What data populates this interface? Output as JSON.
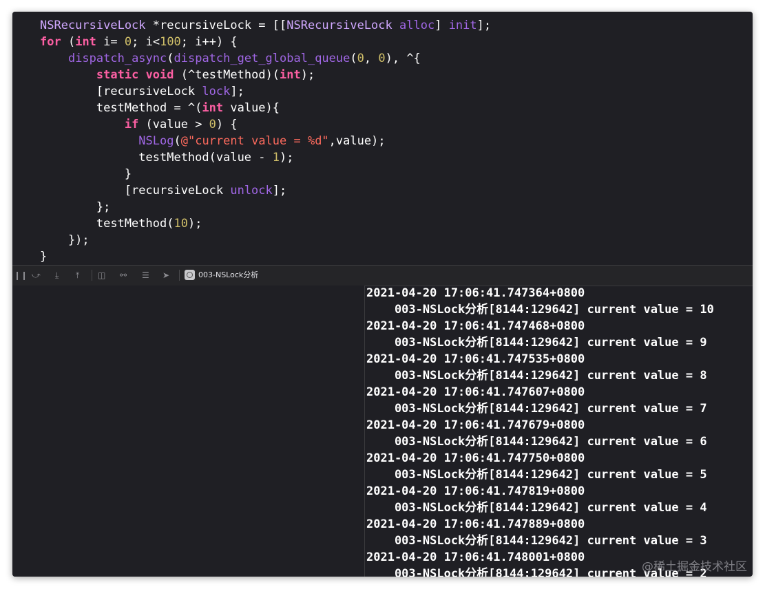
{
  "editor": {
    "lines": [
      [
        {
          "t": "NSRecursiveLock",
          "c": "cls"
        },
        {
          "t": " *recursiveLock = [[",
          "c": "plain"
        },
        {
          "t": "NSRecursiveLock",
          "c": "cls"
        },
        {
          "t": " ",
          "c": "plain"
        },
        {
          "t": "alloc",
          "c": "fn"
        },
        {
          "t": "] ",
          "c": "plain"
        },
        {
          "t": "init",
          "c": "fn"
        },
        {
          "t": "];",
          "c": "plain"
        }
      ],
      [
        {
          "t": "for",
          "c": "kw"
        },
        {
          "t": " (",
          "c": "plain"
        },
        {
          "t": "int",
          "c": "kw"
        },
        {
          "t": " i= ",
          "c": "plain"
        },
        {
          "t": "0",
          "c": "num"
        },
        {
          "t": "; i<",
          "c": "plain"
        },
        {
          "t": "100",
          "c": "num"
        },
        {
          "t": "; i++) {",
          "c": "plain"
        }
      ],
      [
        {
          "t": "    ",
          "c": "plain"
        },
        {
          "t": "dispatch_async",
          "c": "fn"
        },
        {
          "t": "(",
          "c": "plain"
        },
        {
          "t": "dispatch_get_global_queue",
          "c": "fn"
        },
        {
          "t": "(",
          "c": "plain"
        },
        {
          "t": "0",
          "c": "num"
        },
        {
          "t": ", ",
          "c": "plain"
        },
        {
          "t": "0",
          "c": "num"
        },
        {
          "t": "), ^{",
          "c": "plain"
        }
      ],
      [
        {
          "t": "        ",
          "c": "plain"
        },
        {
          "t": "static",
          "c": "kw"
        },
        {
          "t": " ",
          "c": "plain"
        },
        {
          "t": "void",
          "c": "kw"
        },
        {
          "t": " (^testMethod)(",
          "c": "plain"
        },
        {
          "t": "int",
          "c": "kw"
        },
        {
          "t": ");",
          "c": "plain"
        }
      ],
      [
        {
          "t": "        [recursiveLock ",
          "c": "plain"
        },
        {
          "t": "lock",
          "c": "fn"
        },
        {
          "t": "];",
          "c": "plain"
        }
      ],
      [
        {
          "t": "        testMethod = ^(",
          "c": "plain"
        },
        {
          "t": "int",
          "c": "kw"
        },
        {
          "t": " value){",
          "c": "plain"
        }
      ],
      [
        {
          "t": "            ",
          "c": "plain"
        },
        {
          "t": "if",
          "c": "kw"
        },
        {
          "t": " (value > ",
          "c": "plain"
        },
        {
          "t": "0",
          "c": "num"
        },
        {
          "t": ") {",
          "c": "plain"
        }
      ],
      [
        {
          "t": "              ",
          "c": "plain"
        },
        {
          "t": "NSLog",
          "c": "fn"
        },
        {
          "t": "(",
          "c": "plain"
        },
        {
          "t": "@\"current value = %d\"",
          "c": "str"
        },
        {
          "t": ",value);",
          "c": "plain"
        }
      ],
      [
        {
          "t": "              testMethod(value - ",
          "c": "plain"
        },
        {
          "t": "1",
          "c": "num"
        },
        {
          "t": ");",
          "c": "plain"
        }
      ],
      [
        {
          "t": "            }",
          "c": "plain"
        }
      ],
      [
        {
          "t": "            [recursiveLock ",
          "c": "plain"
        },
        {
          "t": "unlock",
          "c": "fn"
        },
        {
          "t": "];",
          "c": "plain"
        }
      ],
      [
        {
          "t": "        };",
          "c": "plain"
        }
      ],
      [
        {
          "t": "        testMethod(",
          "c": "plain"
        },
        {
          "t": "10",
          "c": "num"
        },
        {
          "t": ");",
          "c": "plain"
        }
      ],
      [
        {
          "t": "    });",
          "c": "plain"
        }
      ],
      [
        {
          "t": "}",
          "c": "plain"
        }
      ]
    ]
  },
  "debug_bar": {
    "target_label": "003-NSLock分析"
  },
  "console": {
    "lines": [
      "2021-04-20 17:06:41.747364+0800",
      "    003-NSLock分析[8144:129642] current value = 10",
      "2021-04-20 17:06:41.747468+0800",
      "    003-NSLock分析[8144:129642] current value = 9",
      "2021-04-20 17:06:41.747535+0800",
      "    003-NSLock分析[8144:129642] current value = 8",
      "2021-04-20 17:06:41.747607+0800",
      "    003-NSLock分析[8144:129642] current value = 7",
      "2021-04-20 17:06:41.747679+0800",
      "    003-NSLock分析[8144:129642] current value = 6",
      "2021-04-20 17:06:41.747750+0800",
      "    003-NSLock分析[8144:129642] current value = 5",
      "2021-04-20 17:06:41.747819+0800",
      "    003-NSLock分析[8144:129642] current value = 4",
      "2021-04-20 17:06:41.747889+0800",
      "    003-NSLock分析[8144:129642] current value = 3",
      "2021-04-20 17:06:41.748001+0800",
      "    003-NSLock分析[8144:129642] current value = 2"
    ]
  },
  "watermark": "@稀土掘金技术社区",
  "colors": {
    "background": "#1f1f24",
    "keyword": "#fc5fa3",
    "class": "#d0a8ff",
    "function": "#a167e6",
    "number": "#d0bf69",
    "string": "#fc6a5d"
  },
  "icons": [
    "pause-icon",
    "step-over-icon",
    "step-into-icon",
    "step-out-icon",
    "view-hierarchy-icon",
    "memory-graph-icon",
    "environment-overrides-icon",
    "location-icon",
    "app-target-icon"
  ]
}
